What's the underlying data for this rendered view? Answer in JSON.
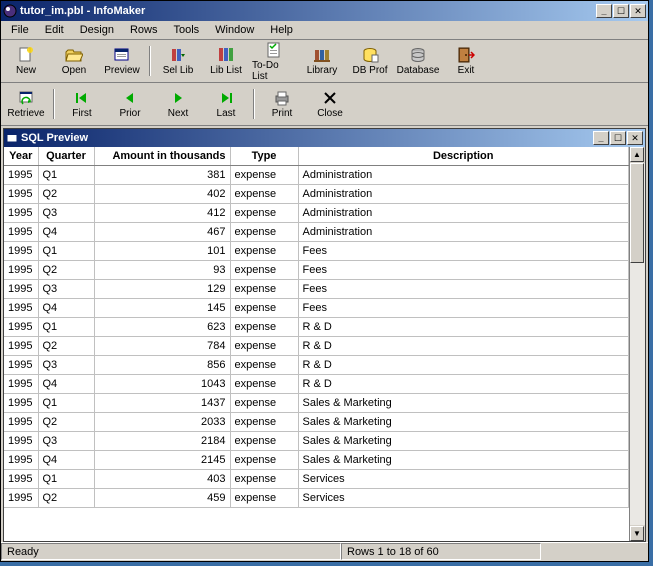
{
  "app": {
    "title": "tutor_im.pbl - InfoMaker"
  },
  "menu": {
    "items": [
      "File",
      "Edit",
      "Design",
      "Rows",
      "Tools",
      "Window",
      "Help"
    ]
  },
  "toolbar1": {
    "items": [
      {
        "label": "New",
        "icon": "new"
      },
      {
        "label": "Open",
        "icon": "open"
      },
      {
        "label": "Preview",
        "icon": "preview"
      },
      {
        "sep": true
      },
      {
        "label": "Sel Lib",
        "icon": "sellib"
      },
      {
        "label": "Lib List",
        "icon": "liblist"
      },
      {
        "label": "To-Do List",
        "icon": "todo"
      },
      {
        "label": "Library",
        "icon": "library"
      },
      {
        "label": "DB Prof",
        "icon": "dbprof"
      },
      {
        "label": "Database",
        "icon": "database"
      },
      {
        "label": "Exit",
        "icon": "exit"
      }
    ]
  },
  "toolbar2": {
    "items": [
      {
        "label": "Retrieve",
        "icon": "retrieve"
      },
      {
        "sep": true
      },
      {
        "label": "First",
        "icon": "first"
      },
      {
        "label": "Prior",
        "icon": "prior"
      },
      {
        "label": "Next",
        "icon": "next"
      },
      {
        "label": "Last",
        "icon": "last"
      },
      {
        "sep": true
      },
      {
        "label": "Print",
        "icon": "print"
      },
      {
        "label": "Close",
        "icon": "close"
      }
    ]
  },
  "child": {
    "title": "SQL Preview"
  },
  "grid": {
    "columns": [
      "Year",
      "Quarter",
      "Amount in thousands",
      "Type",
      "Description"
    ],
    "rows": [
      {
        "year": "1995",
        "quarter": "Q1",
        "amount": "381",
        "type": "expense",
        "desc": "Administration"
      },
      {
        "year": "1995",
        "quarter": "Q2",
        "amount": "402",
        "type": "expense",
        "desc": "Administration"
      },
      {
        "year": "1995",
        "quarter": "Q3",
        "amount": "412",
        "type": "expense",
        "desc": "Administration"
      },
      {
        "year": "1995",
        "quarter": "Q4",
        "amount": "467",
        "type": "expense",
        "desc": "Administration"
      },
      {
        "year": "1995",
        "quarter": "Q1",
        "amount": "101",
        "type": "expense",
        "desc": "Fees"
      },
      {
        "year": "1995",
        "quarter": "Q2",
        "amount": "93",
        "type": "expense",
        "desc": "Fees"
      },
      {
        "year": "1995",
        "quarter": "Q3",
        "amount": "129",
        "type": "expense",
        "desc": "Fees"
      },
      {
        "year": "1995",
        "quarter": "Q4",
        "amount": "145",
        "type": "expense",
        "desc": "Fees"
      },
      {
        "year": "1995",
        "quarter": "Q1",
        "amount": "623",
        "type": "expense",
        "desc": "R & D"
      },
      {
        "year": "1995",
        "quarter": "Q2",
        "amount": "784",
        "type": "expense",
        "desc": "R & D"
      },
      {
        "year": "1995",
        "quarter": "Q3",
        "amount": "856",
        "type": "expense",
        "desc": "R & D"
      },
      {
        "year": "1995",
        "quarter": "Q4",
        "amount": "1043",
        "type": "expense",
        "desc": "R & D"
      },
      {
        "year": "1995",
        "quarter": "Q1",
        "amount": "1437",
        "type": "expense",
        "desc": "Sales & Marketing"
      },
      {
        "year": "1995",
        "quarter": "Q2",
        "amount": "2033",
        "type": "expense",
        "desc": "Sales & Marketing"
      },
      {
        "year": "1995",
        "quarter": "Q3",
        "amount": "2184",
        "type": "expense",
        "desc": "Sales & Marketing"
      },
      {
        "year": "1995",
        "quarter": "Q4",
        "amount": "2145",
        "type": "expense",
        "desc": "Sales & Marketing"
      },
      {
        "year": "1995",
        "quarter": "Q1",
        "amount": "403",
        "type": "expense",
        "desc": "Services"
      },
      {
        "year": "1995",
        "quarter": "Q2",
        "amount": "459",
        "type": "expense",
        "desc": "Services"
      }
    ]
  },
  "status": {
    "ready": "Ready",
    "rows": "Rows 1 to 18 of 60"
  },
  "winctl": {
    "min": "_",
    "max": "☐",
    "restore": "❐",
    "close": "✕"
  }
}
